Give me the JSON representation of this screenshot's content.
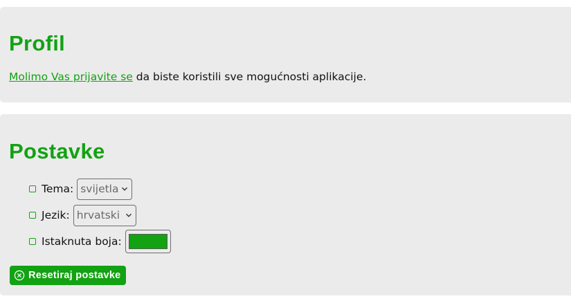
{
  "colors": {
    "accent": "#12a212",
    "panel_bg": "#ebebeb",
    "page_bg": "#ffffff"
  },
  "profile": {
    "title": "Profil",
    "login_link": "Molimo Vas prijavite se",
    "login_suffix": " da biste koristili sve mogućnosti aplikacije."
  },
  "settings": {
    "title": "Postavke",
    "theme": {
      "label": "Tema:",
      "value": "svijetla",
      "icon": "chevron-down-icon"
    },
    "language": {
      "label": "Jezik:",
      "value": "hrvatski",
      "icon": "chevron-down-icon"
    },
    "accent_color": {
      "label": "Istaknuta boja:",
      "value": "#12a212"
    },
    "reset_button": {
      "label": "Resetiraj postavke",
      "icon": "close-circle-icon"
    }
  }
}
